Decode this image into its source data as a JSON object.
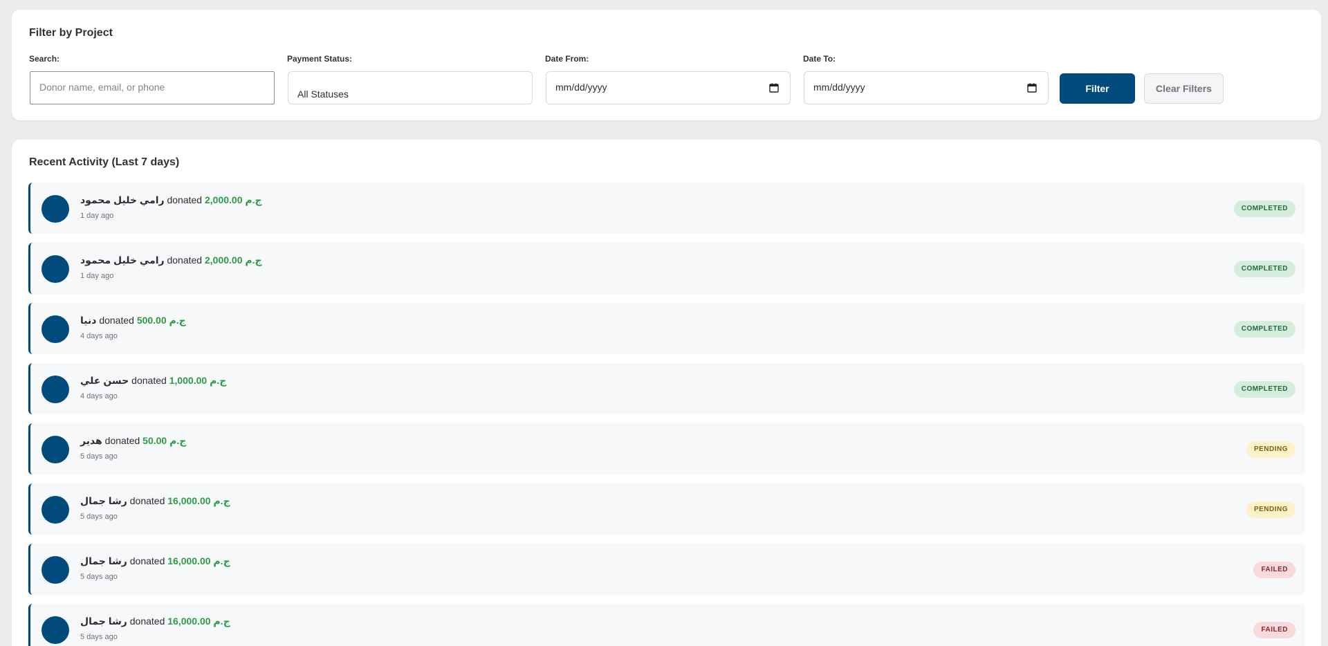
{
  "filter": {
    "title": "Filter by Project",
    "search_label": "Search:",
    "search_placeholder": "Donor name, email, or phone",
    "status_label": "Payment Status:",
    "status_value": "All Statuses",
    "date_from_label": "Date From:",
    "date_from_value": "mm/dd/yyyy",
    "date_to_label": "Date To:",
    "date_to_value": "mm/dd/yyyy",
    "filter_button": "Filter",
    "clear_button": "Clear Filters"
  },
  "activity": {
    "title": "Recent Activity (Last 7 days)",
    "verb": "donated",
    "items": [
      {
        "donor": "رامي خليل محمود",
        "amount": "2,000.00 ج.م",
        "time": "1 day ago",
        "status": "COMPLETED"
      },
      {
        "donor": "رامي خليل محمود",
        "amount": "2,000.00 ج.م",
        "time": "1 day ago",
        "status": "COMPLETED"
      },
      {
        "donor": "دنيا",
        "amount": "500.00 ج.م",
        "time": "4 days ago",
        "status": "COMPLETED"
      },
      {
        "donor": "حسن علي",
        "amount": "1,000.00 ج.م",
        "time": "4 days ago",
        "status": "COMPLETED"
      },
      {
        "donor": "هدير",
        "amount": "50.00 ج.م",
        "time": "5 days ago",
        "status": "PENDING"
      },
      {
        "donor": "رشا جمال",
        "amount": "16,000.00 ج.م",
        "time": "5 days ago",
        "status": "PENDING"
      },
      {
        "donor": "رشا جمال",
        "amount": "16,000.00 ج.م",
        "time": "5 days ago",
        "status": "FAILED"
      },
      {
        "donor": "رشا جمال",
        "amount": "16,000.00 ج.م",
        "time": "5 days ago",
        "status": "FAILED"
      }
    ]
  },
  "colors": {
    "primary": "#004a7c",
    "amount": "#2e9a47",
    "completed_bg": "#d5eddc",
    "pending_bg": "#fdf2c8",
    "failed_bg": "#f8d9dc"
  }
}
